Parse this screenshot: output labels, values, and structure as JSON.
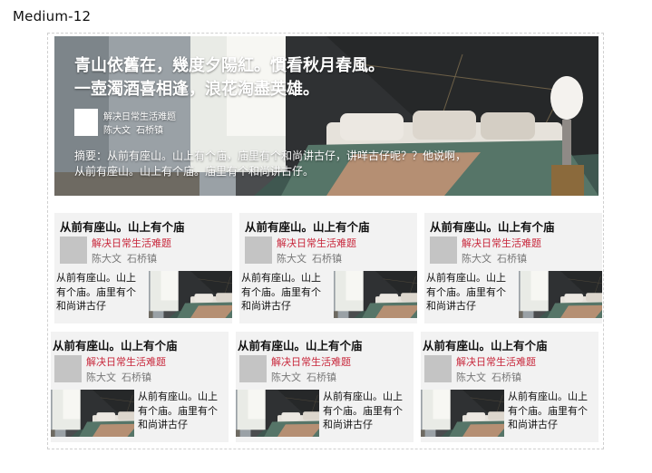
{
  "page_label": "Medium-12",
  "hero": {
    "title_line1": "青山依舊在，幾度夕陽紅。慣看秋月春風。",
    "title_line2": "一壺濁酒喜相逢，浪花淘盡英雄。",
    "subtitle": "解决日常生活难题",
    "author": "陈大文",
    "location": "石桥镇",
    "abstract": "摘要：从前有座山。山上有个庙，庙里有个和尚讲古仔，讲咩古仔呢？？他说啊，从前有座山。山上有个庙。庙里有个和尚讲古仔。"
  },
  "cards": [
    {
      "title": "从前有座山。山上有个庙",
      "subtitle": "解决日常生活难题",
      "author": "陈大文",
      "location": "石桥镇",
      "body": "从前有座山。山上有个庙。庙里有个和尚讲古仔"
    },
    {
      "title": "从前有座山。山上有个庙",
      "subtitle": "解决日常生活难题",
      "author": "陈大文",
      "location": "石桥镇",
      "body": "从前有座山。山上有个庙。庙里有个和尚讲古仔"
    },
    {
      "title": "从前有座山。山上有个庙",
      "subtitle": "解决日常生活难题",
      "author": "陈大文",
      "location": "石桥镇",
      "body": "从前有座山。山上有个庙。庙里有个和尚讲古仔"
    },
    {
      "title": "从前有座山。山上有个庙",
      "subtitle": "解决日常生活难题",
      "author": "陈大文",
      "location": "石桥镇",
      "body": "从前有座山。山上有个庙。庙里有个和尚讲古仔"
    },
    {
      "title": "从前有座山。山上有个庙",
      "subtitle": "解决日常生活难题",
      "author": "陈大文",
      "location": "石桥镇",
      "body": "从前有座山。山上有个庙。庙里有个和尚讲古仔"
    },
    {
      "title": "从前有座山。山上有个庙",
      "subtitle": "解决日常生活难题",
      "author": "陈大文",
      "location": "石桥镇",
      "body": "从前有座山。山上有个庙。庙里有个和尚讲古仔"
    }
  ]
}
